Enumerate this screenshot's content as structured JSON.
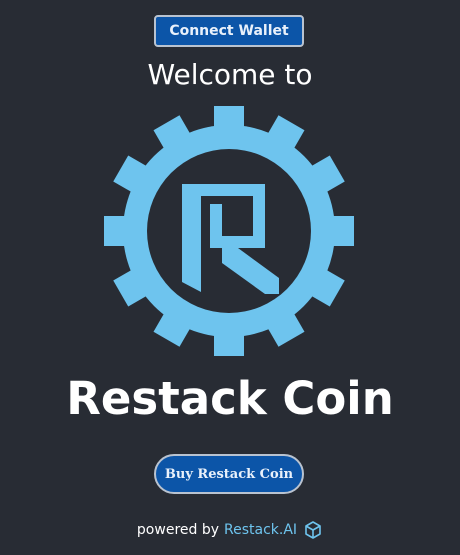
{
  "header": {
    "connect_wallet_label": "Connect Wallet"
  },
  "hero": {
    "welcome_text": "Welcome to",
    "title": "Restack Coin",
    "buy_button_label": "Buy Restack Coin"
  },
  "footer": {
    "powered_by_text": "powered by",
    "brand_link_text": "Restack.AI"
  },
  "icons": {
    "logo": "restack-gear-logo-icon",
    "footer": "cube-icon"
  },
  "colors": {
    "background": "#282c34",
    "button_bg": "#0c55a8",
    "button_border": "#b9c3d0",
    "logo": "#6ec4ee",
    "link": "#6ec4ee"
  }
}
